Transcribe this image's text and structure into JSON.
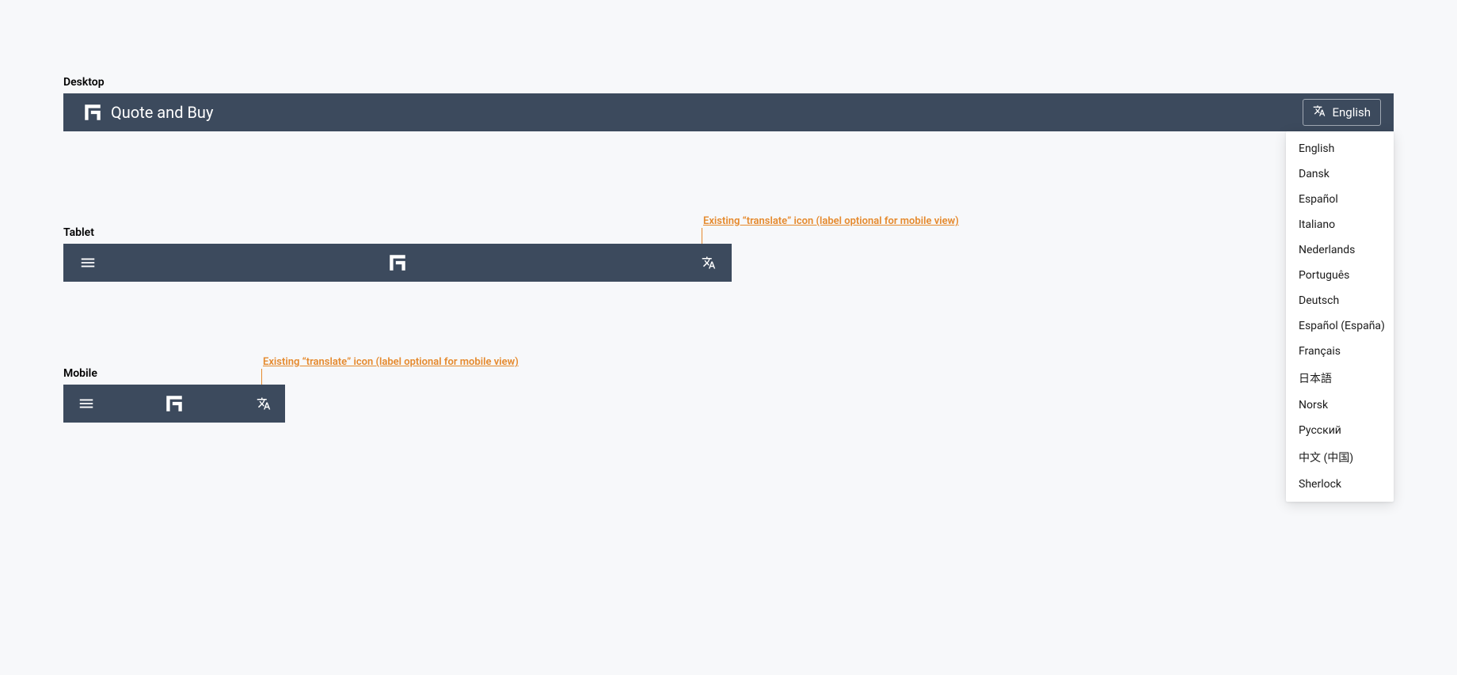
{
  "sections": {
    "desktop": {
      "label": "Desktop"
    },
    "tablet": {
      "label": "Tablet"
    },
    "mobile": {
      "label": "Mobile"
    }
  },
  "header": {
    "title": "Quote and Buy"
  },
  "language_button": {
    "label": "English"
  },
  "language_dropdown": {
    "options": [
      "English",
      "Dansk",
      "Español",
      "Italiano",
      "Nederlands",
      "Português",
      "Deutsch",
      "Español (España)",
      "Français",
      "日本語",
      "Norsk",
      "Русский",
      "中文 (中国)",
      "Sherlock"
    ]
  },
  "annotations": {
    "tablet": "Existing “translate” icon (label optional for mobile view)",
    "mobile": "Existing “translate” icon (label optional for mobile view)"
  }
}
